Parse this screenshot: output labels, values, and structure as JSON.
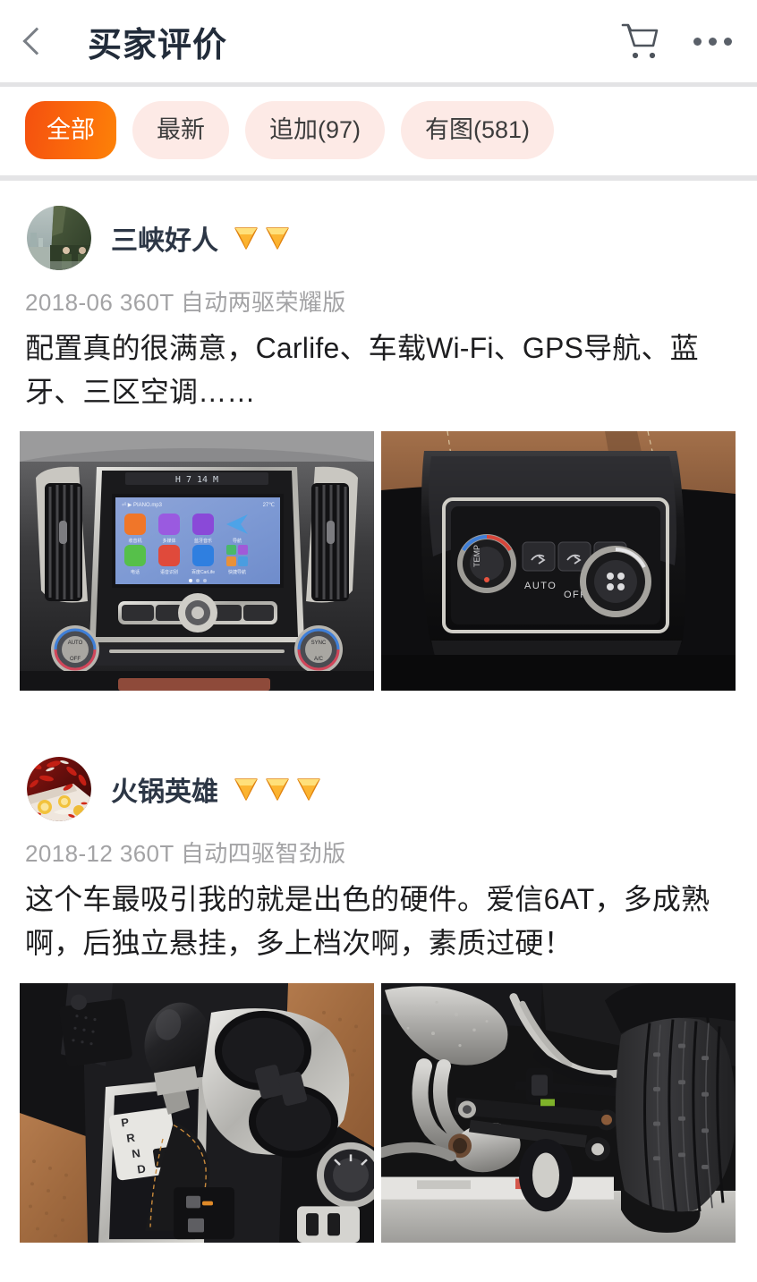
{
  "header": {
    "back_icon": "chevron-left-icon",
    "title": "买家评价",
    "cart_icon": "shopping-cart-icon",
    "more_icon": "more-horizontal-icon"
  },
  "filters": {
    "tabs": [
      {
        "label": "全部",
        "active": true
      },
      {
        "label": "最新",
        "active": false
      },
      {
        "label": "追加(97)",
        "active": false
      },
      {
        "label": "有图(581)",
        "active": false
      }
    ]
  },
  "colors": {
    "accent_start": "#f4500f",
    "accent_end": "#fd8208",
    "tab_inactive_bg": "#fdeae6",
    "title": "#222c3a",
    "meta_text": "#a3a3a5",
    "body_text": "#1d1d1f",
    "divider": "#e4e4e6"
  },
  "reviews": [
    {
      "avatar_icon": "user-avatar-photo",
      "username": "三峡好人",
      "gem_count": 2,
      "meta": "2018-06 360T 自动两驱荣耀版",
      "text": "配置真的很满意，Carlife、车载Wi-Fi、GPS导航、蓝牙、三区空调……",
      "photos": [
        {
          "alt": "car-dashboard-infotainment-photo"
        },
        {
          "alt": "rear-climate-control-panel-photo"
        }
      ]
    },
    {
      "avatar_icon": "user-avatar-photo",
      "username": "火锅英雄",
      "gem_count": 3,
      "meta": "2018-12 360T 自动四驱智劲版",
      "text": "这个车最吸引我的就是出色的硬件。爱信6AT，多成熟啊，后独立悬挂，多上档次啊，素质过硬！",
      "photos": [
        {
          "alt": "gear-shifter-center-console-photo"
        },
        {
          "alt": "undercarriage-suspension-tire-photo"
        }
      ]
    }
  ]
}
